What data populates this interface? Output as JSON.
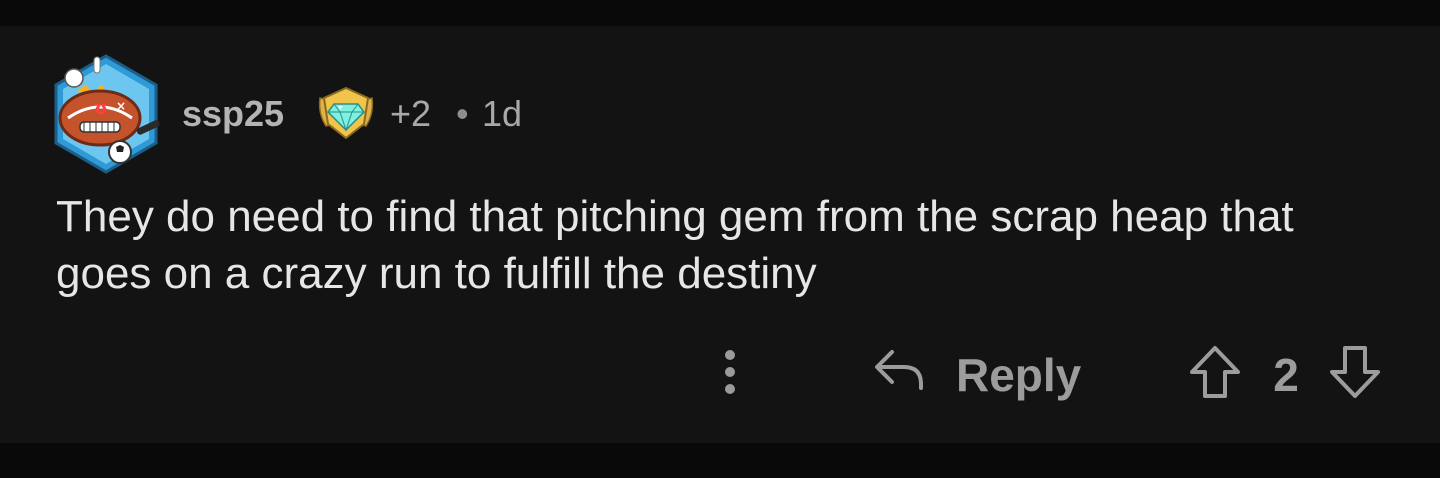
{
  "comment": {
    "username": "ssp25",
    "award_count": "+2",
    "separator": "•",
    "timestamp": "1d",
    "body": "They do need to find that pitching gem from the scrap heap that goes on a crazy run to fulfill the destiny"
  },
  "actions": {
    "reply_label": "Reply",
    "vote_count": "2"
  },
  "icons": {
    "avatar": "football-character-avatar",
    "badge": "diamond-achievement-badge",
    "more": "vertical-ellipsis-icon",
    "reply": "reply-arrow-icon",
    "upvote": "upvote-arrow-icon",
    "downvote": "downvote-arrow-icon"
  },
  "colors": {
    "background": "#131313",
    "text": "#e6e6e6",
    "muted": "#9c9c9c"
  }
}
